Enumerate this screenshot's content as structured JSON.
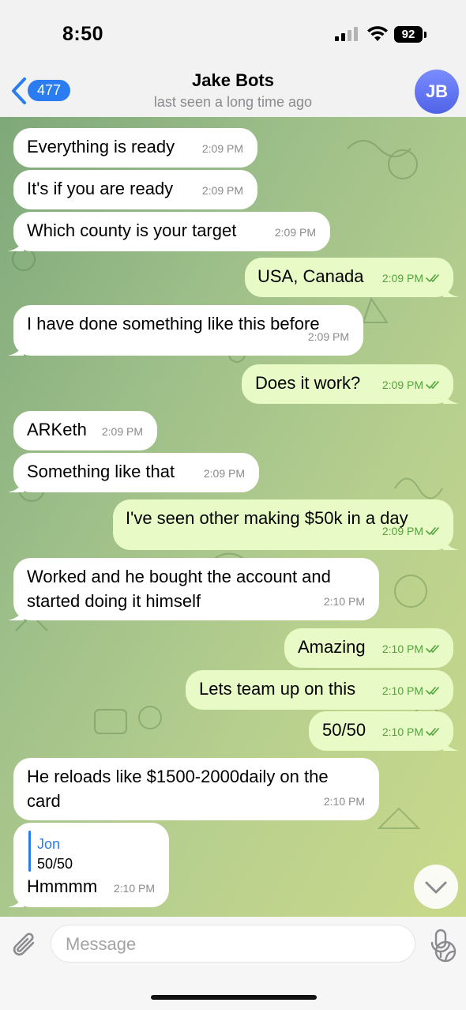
{
  "status_bar": {
    "time": "8:50",
    "battery": "92"
  },
  "header": {
    "back_count": "477",
    "title": "Jake Bots",
    "subtitle": "last seen a long time ago",
    "avatar_initials": "JB"
  },
  "messages": [
    {
      "dir": "in",
      "text": "Everything is ready",
      "time": "2:09 PM"
    },
    {
      "dir": "in",
      "text": "It's if you are ready",
      "time": "2:09 PM"
    },
    {
      "dir": "in",
      "text": "Which county is your target",
      "time": "2:09 PM"
    },
    {
      "dir": "out",
      "text": "USA, Canada",
      "time": "2:09 PM"
    },
    {
      "dir": "in",
      "text": "I have done something like this before",
      "time": "2:09 PM"
    },
    {
      "dir": "out",
      "text": "Does it work?",
      "time": "2:09 PM"
    },
    {
      "dir": "in",
      "text": "ARKeth",
      "time": "2:09 PM"
    },
    {
      "dir": "in",
      "text": "Something like that",
      "time": "2:09 PM"
    },
    {
      "dir": "out",
      "text": "I've seen other making $50k in a day",
      "time": "2:09 PM"
    },
    {
      "dir": "in",
      "text": "Worked and he bought the account and",
      "text2": "started doing it himself",
      "time": "2:10 PM"
    },
    {
      "dir": "out",
      "text": "Amazing",
      "time": "2:10 PM"
    },
    {
      "dir": "out",
      "text": "Lets team up on this",
      "time": "2:10 PM"
    },
    {
      "dir": "out",
      "text": "50/50",
      "time": "2:10 PM"
    },
    {
      "dir": "in",
      "text": "He reloads like $1500-2000daily on the",
      "text2": "card",
      "time": "2:10 PM"
    },
    {
      "dir": "in",
      "reply_name": "Jon",
      "reply_text": "50/50",
      "text": "Hmmmm",
      "time": "2:10 PM"
    }
  ],
  "composer": {
    "placeholder": "Message"
  },
  "icons": {
    "back": "chevron-left-icon",
    "attach": "paperclip-icon",
    "sticker": "sticker-icon",
    "mic": "microphone-icon",
    "scroll": "chevron-down-icon",
    "read": "double-check-icon"
  },
  "colors": {
    "accent": "#2c7cf1",
    "incoming_bubble": "#ffffff",
    "outgoing_bubble": "#e8fbc6",
    "outgoing_meta": "#53a33c"
  }
}
